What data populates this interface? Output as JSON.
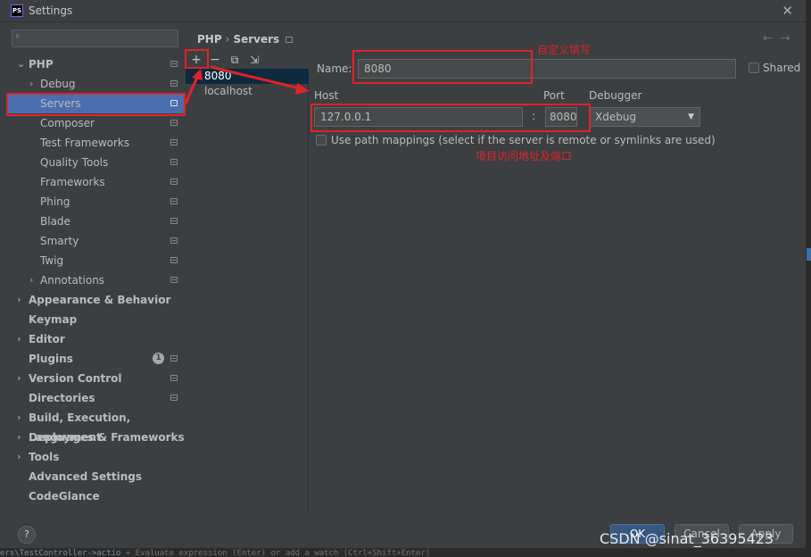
{
  "window": {
    "title": "Settings",
    "app_icon_text": "PS",
    "close": "✕"
  },
  "search": {
    "placeholder": ""
  },
  "tree": {
    "php": "PHP",
    "debug": "Debug",
    "servers": "Servers",
    "composer": "Composer",
    "test_frameworks": "Test Frameworks",
    "quality_tools": "Quality Tools",
    "frameworks": "Frameworks",
    "phing": "Phing",
    "blade": "Blade",
    "smarty": "Smarty",
    "twig": "Twig",
    "annotations": "Annotations",
    "appearance": "Appearance & Behavior",
    "keymap": "Keymap",
    "editor": "Editor",
    "plugins": "Plugins",
    "plugins_badge": "1",
    "version_control": "Version Control",
    "directories": "Directories",
    "build": "Build, Execution, Deployment",
    "languages": "Languages & Frameworks",
    "tools": "Tools",
    "advanced": "Advanced Settings",
    "codeglance": "CodeGlance"
  },
  "breadcrumb": {
    "root": "PHP",
    "sep": "›",
    "leaf": "Servers"
  },
  "nav": {
    "back": "←",
    "forward": "→"
  },
  "toolbar": {
    "add": "+",
    "remove": "−",
    "copy": "⧉",
    "import": "⇲"
  },
  "servers": {
    "items": [
      "8080",
      "localhost"
    ]
  },
  "form": {
    "name_label": "Name:",
    "name_value": "8080",
    "shared_label": "Shared",
    "host_label": "Host",
    "port_label": "Port",
    "debugger_label": "Debugger",
    "host_value": "127.0.0.1",
    "colon": ":",
    "port_value": "8080",
    "debugger_value": "Xdebug",
    "path_mappings_label": "Use path mappings (select if the server is remote or symlinks are used)"
  },
  "annotations": {
    "custom_fill": "自定义填写",
    "project_address": "项目访问地址及端口"
  },
  "buttons": {
    "help": "?",
    "ok": "OK",
    "cancel": "Cancel",
    "apply": "Apply"
  },
  "status": {
    "left": "ers\\TestController->actio",
    "plus": "+",
    "hint": "Evaluate expression (Enter) or add a watch (Ctrl+Shift+Enter)"
  },
  "watermark": "CSDN @sinat_36395423",
  "colors": {
    "selection": "#4b6eaf",
    "annotation": "#e0232a",
    "background": "#3c3f41"
  }
}
